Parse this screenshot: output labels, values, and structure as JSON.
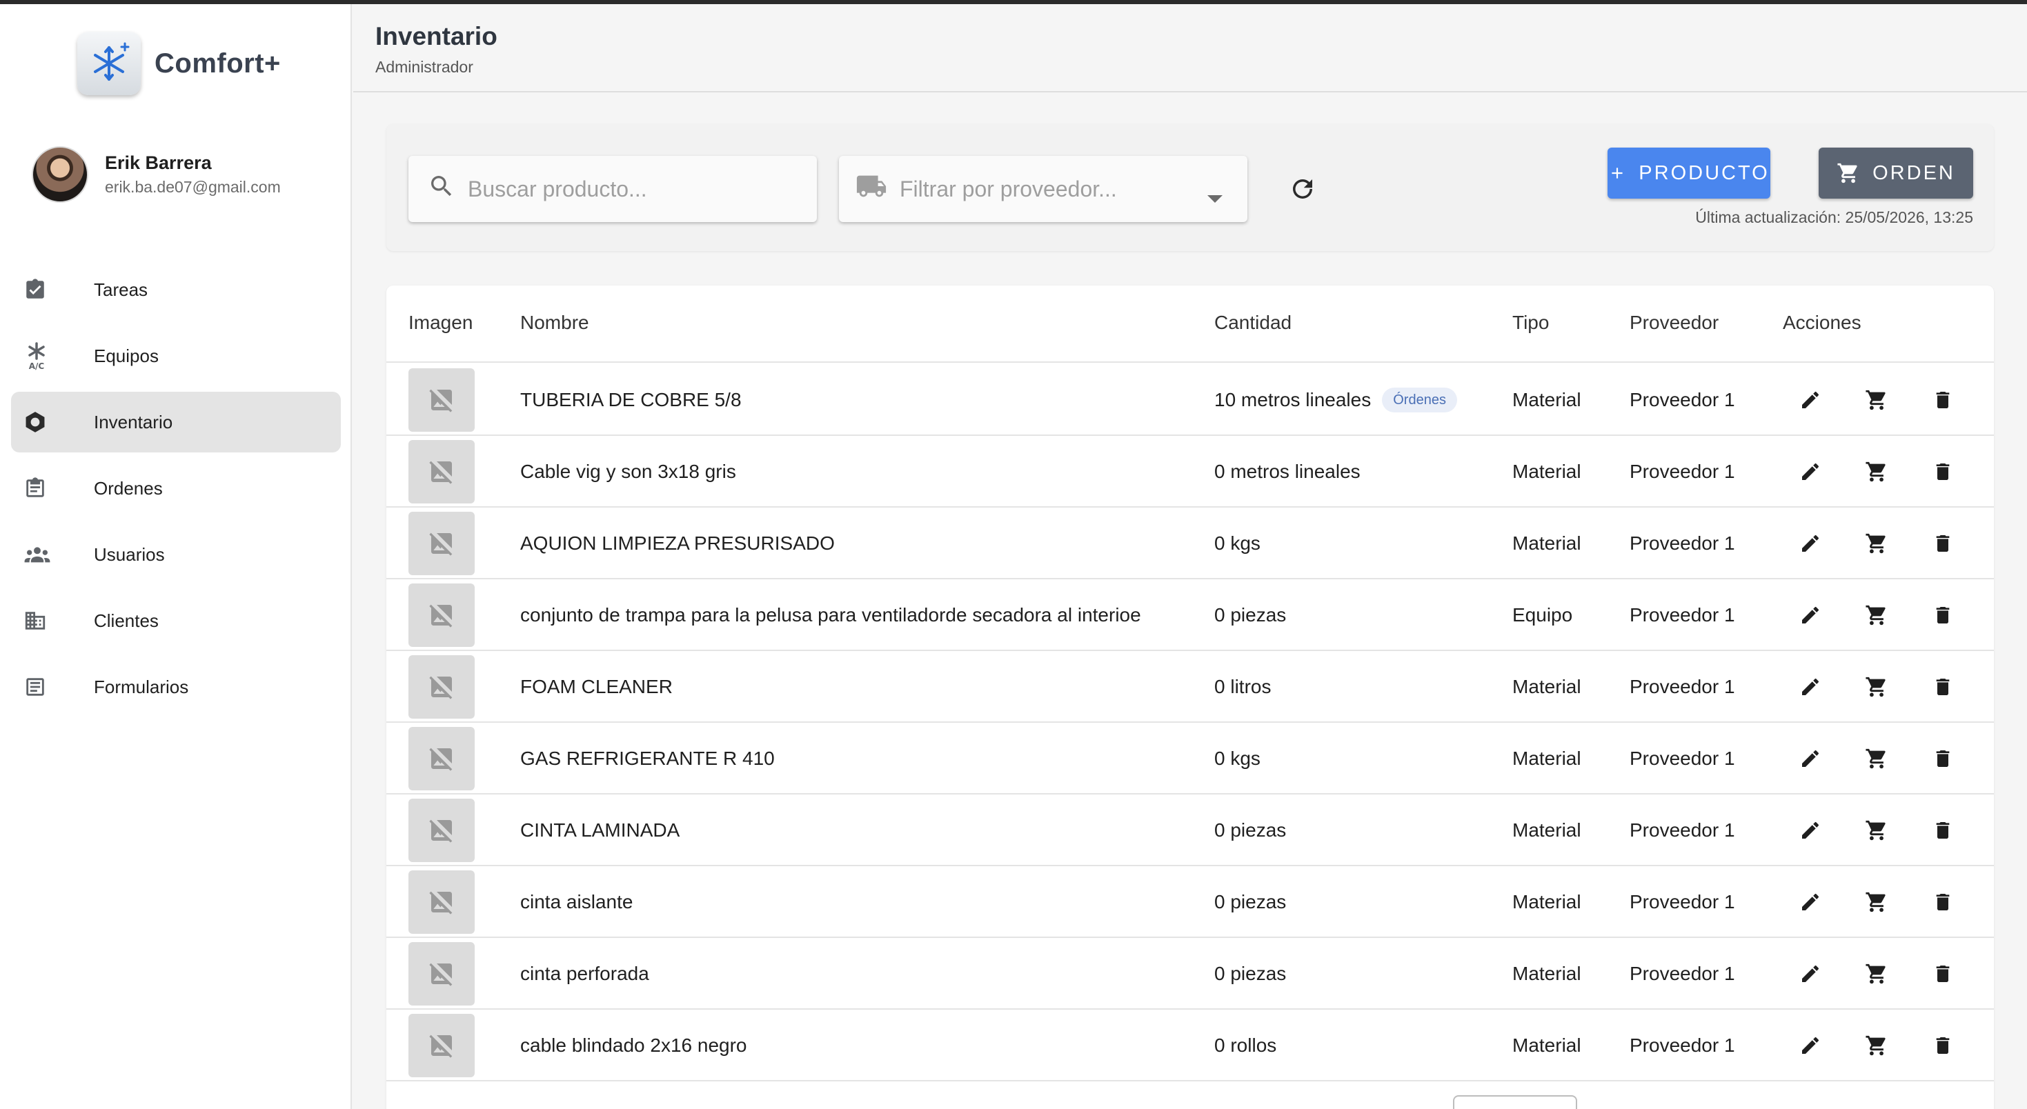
{
  "app": {
    "brand_name": "Comfort+"
  },
  "user": {
    "name": "Erik Barrera",
    "email": "erik.ba.de07@gmail.com"
  },
  "sidebar": {
    "items": [
      {
        "label": "Tareas",
        "icon": "task-check-icon",
        "active": false
      },
      {
        "label": "Equipos",
        "icon": "ac-unit-icon",
        "active": false
      },
      {
        "label": "Inventario",
        "icon": "hexagon-icon",
        "active": true
      },
      {
        "label": "Ordenes",
        "icon": "clipboard-icon",
        "active": false
      },
      {
        "label": "Usuarios",
        "icon": "people-icon",
        "active": false
      },
      {
        "label": "Clientes",
        "icon": "building-icon",
        "active": false
      },
      {
        "label": "Formularios",
        "icon": "form-icon",
        "active": false
      }
    ]
  },
  "header": {
    "title": "Inventario",
    "subtitle": "Administrador"
  },
  "toolbar": {
    "search_placeholder": "Buscar producto...",
    "provider_placeholder": "Filtrar por proveedor...",
    "product_button": "PRODUCTO",
    "order_button": "ORDEN",
    "last_update": "Última actualización: 25/05/2026, 13:25"
  },
  "table": {
    "headers": {
      "image": "Imagen",
      "name": "Nombre",
      "quantity": "Cantidad",
      "type": "Tipo",
      "provider": "Proveedor",
      "actions": "Acciones"
    },
    "rows": [
      {
        "name": "TUBERIA DE COBRE 5/8",
        "quantity": "10 metros lineales",
        "badge": "Órdenes",
        "type": "Material",
        "provider": "Proveedor 1"
      },
      {
        "name": "Cable vig y son 3x18 gris",
        "quantity": "0 metros lineales",
        "type": "Material",
        "provider": "Proveedor 1"
      },
      {
        "name": "AQUION LIMPIEZA PRESURISADO",
        "quantity": "0 kgs",
        "type": "Material",
        "provider": "Proveedor 1"
      },
      {
        "name": "conjunto de trampa para la pelusa para ventiladorde secadora al interioe",
        "quantity": "0 piezas",
        "type": "Equipo",
        "provider": "Proveedor 1"
      },
      {
        "name": "FOAM CLEANER",
        "quantity": "0 litros",
        "type": "Material",
        "provider": "Proveedor 1"
      },
      {
        "name": "GAS REFRIGERANTE R 410",
        "quantity": "0 kgs",
        "type": "Material",
        "provider": "Proveedor 1"
      },
      {
        "name": "CINTA LAMINADA",
        "quantity": "0 piezas",
        "type": "Material",
        "provider": "Proveedor 1"
      },
      {
        "name": "cinta aislante",
        "quantity": "0 piezas",
        "type": "Material",
        "provider": "Proveedor 1"
      },
      {
        "name": "cinta perforada",
        "quantity": "0 piezas",
        "type": "Material",
        "provider": "Proveedor 1"
      },
      {
        "name": "cable blindado 2x16 negro",
        "quantity": "0 rollos",
        "type": "Material",
        "provider": "Proveedor 1"
      }
    ]
  },
  "colors": {
    "primary_button": "#4a86ee",
    "secondary_button": "#5b6472",
    "active_nav": "#e4e4e4",
    "badge_bg": "#e9eef8",
    "badge_text": "#4a6fb5"
  }
}
